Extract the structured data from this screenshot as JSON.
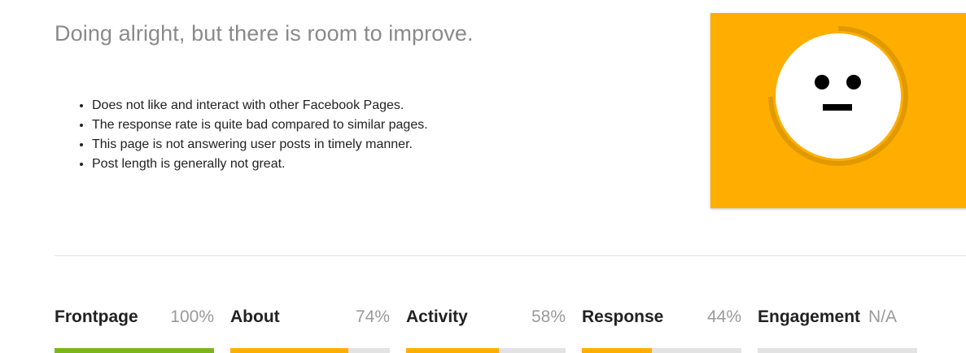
{
  "summary": {
    "headline": "Doing alright, but there is room to improve.",
    "issues": [
      "Does not like and interact with other Facebook Pages.",
      "The response rate is quite bad compared to similar pages.",
      "This page is not answering user posts in timely manner.",
      "Post length is generally not great."
    ]
  },
  "score_card": {
    "mood": "neutral-face-icon",
    "background_color": "#ffae00",
    "ring_color": "#e09a00"
  },
  "metrics": [
    {
      "name": "Frontpage",
      "value": "100%",
      "fraction": 1.0,
      "color": "#7cb518"
    },
    {
      "name": "About",
      "value": "74%",
      "fraction": 0.74,
      "color": "#ffae00"
    },
    {
      "name": "Activity",
      "value": "58%",
      "fraction": 0.58,
      "color": "#ffae00"
    },
    {
      "name": "Response",
      "value": "44%",
      "fraction": 0.44,
      "color": "#ffae00"
    },
    {
      "name": "Engagement",
      "value": "N/A",
      "fraction": 0,
      "color": "#e3e3e3"
    }
  ]
}
